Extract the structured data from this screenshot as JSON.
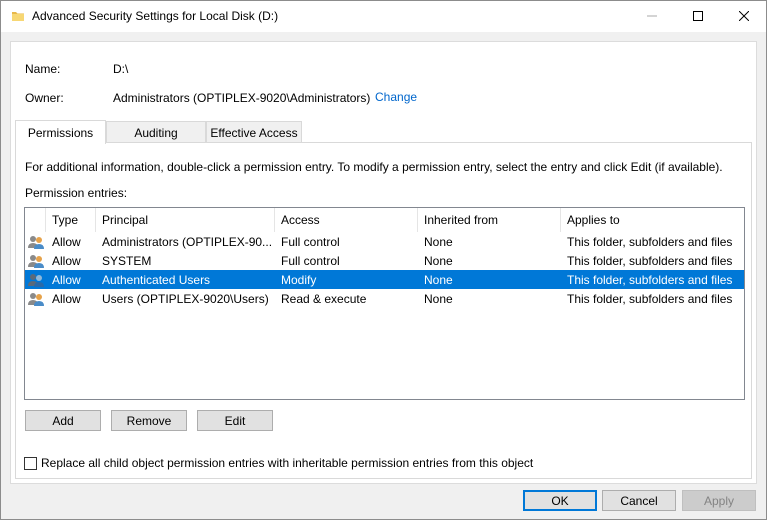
{
  "window": {
    "title": "Advanced Security Settings for Local Disk (D:)"
  },
  "object": {
    "name_label": "Name:",
    "name_value": "D:\\",
    "owner_label": "Owner:",
    "owner_value": "Administrators (OPTIPLEX-9020\\Administrators)",
    "change_link": "Change"
  },
  "tabs": [
    {
      "label": "Permissions",
      "active": true
    },
    {
      "label": "Auditing",
      "active": false
    },
    {
      "label": "Effective Access",
      "active": false
    }
  ],
  "permissions": {
    "info_text": "For additional information, double-click a permission entry. To modify a permission entry, select the entry and click Edit (if available).",
    "entries_label": "Permission entries:",
    "columns": [
      "Type",
      "Principal",
      "Access",
      "Inherited from",
      "Applies to"
    ],
    "rows": [
      {
        "type": "Allow",
        "principal": "Administrators (OPTIPLEX-90...",
        "access": "Full control",
        "inherited": "None",
        "applies": "This folder, subfolders and files",
        "selected": false
      },
      {
        "type": "Allow",
        "principal": "SYSTEM",
        "access": "Full control",
        "inherited": "None",
        "applies": "This folder, subfolders and files",
        "selected": false
      },
      {
        "type": "Allow",
        "principal": "Authenticated Users",
        "access": "Modify",
        "inherited": "None",
        "applies": "This folder, subfolders and files",
        "selected": true
      },
      {
        "type": "Allow",
        "principal": "Users (OPTIPLEX-9020\\Users)",
        "access": "Read & execute",
        "inherited": "None",
        "applies": "This folder, subfolders and files",
        "selected": false
      }
    ],
    "add_button": "Add",
    "remove_button": "Remove",
    "edit_button": "Edit",
    "replace_checkbox_label": "Replace all child object permission entries with inheritable permission entries from this object",
    "replace_checked": false
  },
  "footer": {
    "ok": "OK",
    "cancel": "Cancel",
    "apply": "Apply"
  },
  "colors": {
    "selection": "#0078d7",
    "link": "#0066cc"
  }
}
